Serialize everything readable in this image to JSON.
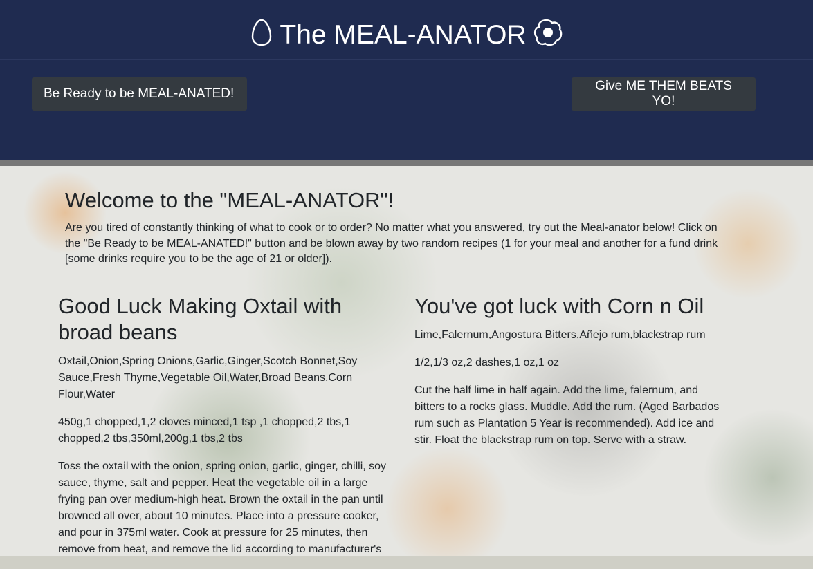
{
  "header": {
    "title": "The MEAL-ANATOR",
    "left_icon": "egg-icon",
    "right_icon": "fried-egg-icon",
    "background_color": "#1f2b50",
    "meal_button_label": "Be Ready to be MEAL-ANATED!",
    "beats_button_label": "Give ME THEM BEATS YO!"
  },
  "welcome": {
    "title": "Welcome to the \"MEAL-ANATOR\"!",
    "text": "Are you tired of constantly thinking of what to cook or to order? No matter what you answered, try out the Meal-anator below! Click on the \"Be Ready to be MEAL-ANATED!\" button and be blown away by two random recipes (1 for your meal and another for a fund drink [some drinks require you to be the age of 21 or older])."
  },
  "meal": {
    "title": "Good Luck Making Oxtail with broad beans",
    "ingredients": "Oxtail,Onion,Spring Onions,Garlic,Ginger,Scotch Bonnet,Soy Sauce,Fresh Thyme,Vegetable Oil,Water,Broad Beans,Corn Flour,Water",
    "measures": "450g,1 chopped,1,2 cloves minced,1 tsp ,1 chopped,2 tbs,1 chopped,2 tbs,350ml,200g,1 tbs,2 tbs",
    "instructions": "Toss the oxtail with the onion, spring onion, garlic, ginger, chilli, soy sauce, thyme, salt and pepper. Heat the vegetable oil in a large frying pan over medium-high heat. Brown the oxtail in the pan until browned all over, about 10 minutes. Place into a pressure cooker, and pour in 375ml water. Cook at pressure for 25 minutes, then remove from heat, and remove the lid according to manufacturer's"
  },
  "drink": {
    "title": "You've got luck with Corn n Oil",
    "ingredients": "Lime,Falernum,Angostura Bitters,Añejo rum,blackstrap rum",
    "measures": "1/2,1/3 oz,2 dashes,1 oz,1 oz",
    "instructions": "Cut the half lime in half again. Add the lime, falernum, and bitters to a rocks glass. Muddle. Add the rum. (Aged Barbados rum such as Plantation 5 Year is recommended). Add ice and stir. Float the blackstrap rum on top. Serve with a straw."
  }
}
